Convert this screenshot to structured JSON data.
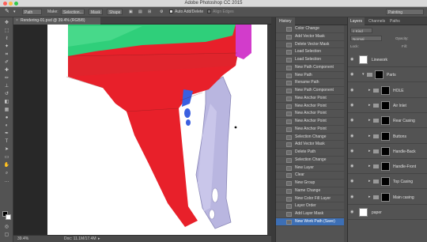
{
  "app": {
    "title": "Adobe Photoshop CC 2015"
  },
  "options": {
    "mode_value": "Path",
    "make_label": "Make:",
    "selection_button": "Selection...",
    "mask_button": "Mask",
    "shape_button": "Shape",
    "auto_add_delete": "Auto Add/Delete",
    "align_edges": "Align Edges",
    "workspace": "Painting"
  },
  "document": {
    "tab_title": "Rendering-01.psd @ 39.4% (RGB/8)",
    "zoom": "39.4%",
    "doc_info": "Doc: 11.1M/17.4M"
  },
  "history": {
    "tab": "History",
    "items": [
      "Color Change",
      "Add Vector Mask",
      "Delete Vector Mask",
      "Load Selection",
      "Load Selection",
      "New Path Component",
      "New Path",
      "Rename Path",
      "New Path Component",
      "New Anchor Point",
      "New Anchor Point",
      "New Anchor Point",
      "New Anchor Point",
      "New Anchor Point",
      "Selection Change",
      "Add Vector Mask",
      "Delete Path",
      "Selection Change",
      "New Layer",
      "Clear",
      "New Group",
      "Name Change",
      "New Color Fill Layer",
      "Layer Order",
      "Add Layer Mask",
      "New Work Path (Save)"
    ],
    "selected_index": 25
  },
  "layers": {
    "tabs": [
      "Layers",
      "Channels",
      "Paths"
    ],
    "kind_filter": "Kind",
    "blend_mode": "Normal",
    "opacity_label": "Opacity:",
    "fill_label": "Fill:",
    "lock_label": "Lock:",
    "items": [
      {
        "name": "Linework",
        "type": "layer"
      },
      {
        "name": "Parts",
        "type": "group"
      },
      {
        "name": "HOLE",
        "type": "sub"
      },
      {
        "name": "Air Inlet",
        "type": "sub"
      },
      {
        "name": "Rear Casing",
        "type": "sub"
      },
      {
        "name": "Buttons",
        "type": "sub"
      },
      {
        "name": "Handle-Back",
        "type": "sub"
      },
      {
        "name": "Handle-Front",
        "type": "sub"
      },
      {
        "name": "Top Casing",
        "type": "sub"
      },
      {
        "name": "Main casing",
        "type": "sub"
      },
      {
        "name": "paper",
        "type": "layer"
      }
    ]
  },
  "colors": {
    "red_casing": "#e8202a",
    "green_top": "#2fcf7a",
    "magenta": "#d23ccb",
    "blue_buttons": "#3a5fe0",
    "lavender_handle": "#b9b6e0",
    "history_selected": "#3d6fb5"
  }
}
